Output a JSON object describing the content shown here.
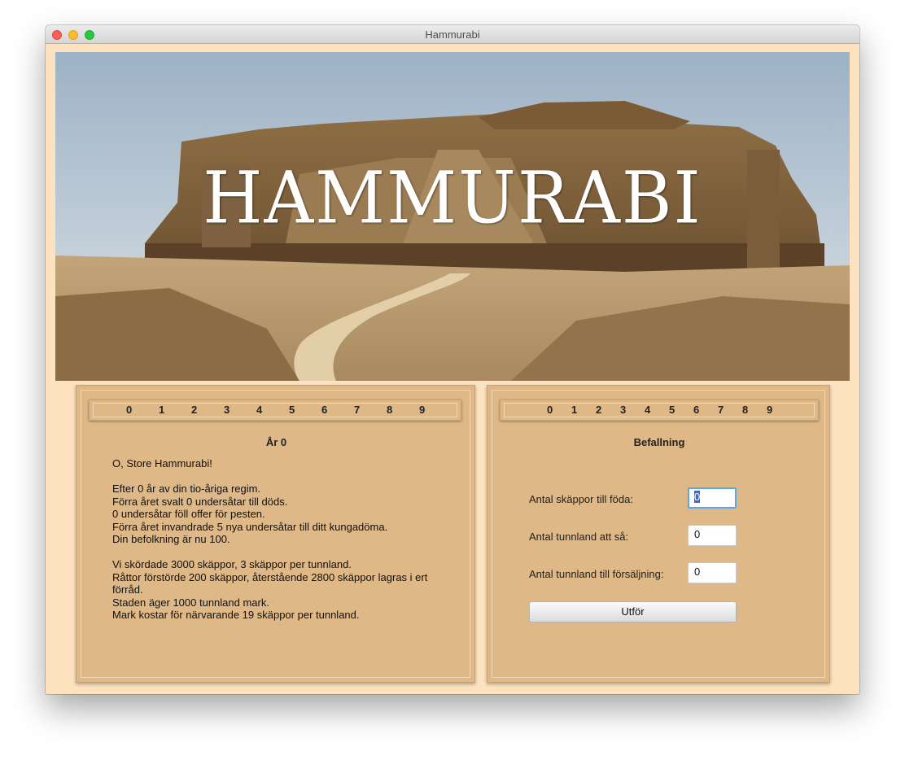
{
  "window": {
    "title": "Hammurabi"
  },
  "banner": {
    "title": "HAMMURABI"
  },
  "left_panel": {
    "year_digits": [
      "0",
      "1",
      "2",
      "3",
      "4",
      "5",
      "6",
      "7",
      "8",
      "9"
    ],
    "heading": "År 0",
    "greeting": "O, Store Hammurabi!",
    "paragraph1": "Efter 0 år av din tio-åriga regim.\nFörra året svalt 0 undersåtar till döds.\n0 undersåtar föll offer för pesten.\nFörra året invandrade 5 nya undersåtar till ditt kungadöma.\nDin befolkning är nu 100.",
    "paragraph2": "Vi skördade 3000 skäppor, 3 skäppor per tunnland.\nRåttor förstörde 200 skäppor, återstående 2800 skäppor lagras i ert förråd.\nStaden äger 1000 tunnland mark.\nMark kostar för närvarande 19 skäppor per tunnland."
  },
  "right_panel": {
    "year_digits": [
      "0",
      "1",
      "2",
      "3",
      "4",
      "5",
      "6",
      "7",
      "8",
      "9"
    ],
    "heading": "Befallning",
    "food_label": "Antal skäppor till föda:",
    "food_value": "0",
    "sow_label": "Antal tunnland att så:",
    "sow_value": "0",
    "sell_label": "Antal tunnland till försäljning:",
    "sell_value": "0",
    "execute_label": "Utför"
  },
  "colors": {
    "window_bg": "#fde2c0",
    "panel_bg": "#deb887",
    "focus_ring": "#5aa8e3"
  }
}
